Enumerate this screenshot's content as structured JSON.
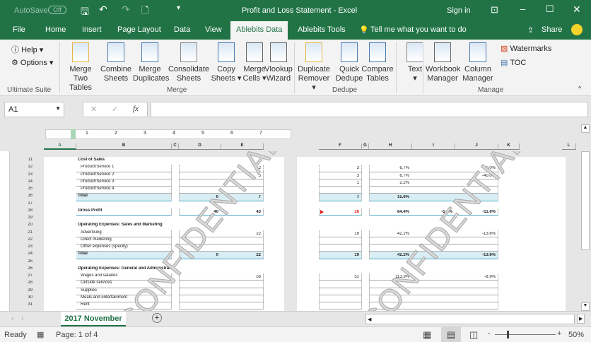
{
  "titlebar": {
    "autosave": "AutoSave",
    "autosave_state": "Off",
    "title": "Profit and Loss Statement  -  Excel",
    "sign_in": "Sign in"
  },
  "tabs": [
    "File",
    "Home",
    "Insert",
    "Page Layout",
    "Data",
    "View",
    "Ablebits Data",
    "Ablebits Tools"
  ],
  "tell_me": "Tell me what you want to do",
  "share": "Share",
  "ribbon": {
    "help": "Help",
    "options": "Options",
    "ultimate_suite": "Ultimate Suite",
    "merge_group": "Merge",
    "dedupe_group": "Dedupe",
    "manage_group": "Manage",
    "buttons": [
      {
        "l1": "Merge",
        "l2": "Two Tables"
      },
      {
        "l1": "Combine",
        "l2": "Sheets"
      },
      {
        "l1": "Merge",
        "l2": "Duplicates"
      },
      {
        "l1": "Consolidate",
        "l2": "Sheets"
      },
      {
        "l1": "Copy",
        "l2": "Sheets ▾"
      },
      {
        "l1": "Merge",
        "l2": "Cells ▾"
      },
      {
        "l1": "Vlookup",
        "l2": "Wizard"
      },
      {
        "l1": "Duplicate",
        "l2": "Remover ▾"
      },
      {
        "l1": "Quick",
        "l2": "Dedupe"
      },
      {
        "l1": "Compare",
        "l2": "Tables"
      },
      {
        "l1": "Text",
        "l2": "▾"
      },
      {
        "l1": "Workbook",
        "l2": "Manager"
      },
      {
        "l1": "Column",
        "l2": "Manager"
      }
    ],
    "watermarks": "Watermarks",
    "toc": "TOC"
  },
  "formula_bar": {
    "name_box": "A1",
    "fx": "fx",
    "value": ""
  },
  "ruler": [
    "1",
    "2",
    "3",
    "4",
    "5",
    "6",
    "7"
  ],
  "columns_left": [
    "A",
    "B",
    "C",
    "D",
    "E"
  ],
  "columns_right": [
    "F",
    "G",
    "H",
    "I",
    "J",
    "K",
    "L"
  ],
  "rows": [
    {
      "n": "11",
      "label": "Cost of Sales",
      "kind": "header"
    },
    {
      "n": "12",
      "label": "Product/Service 1",
      "kind": "item",
      "E": "2",
      "F": "3",
      "H": "6.7%",
      "J": "50.0%"
    },
    {
      "n": "13",
      "label": "Product/Service 2",
      "kind": "item",
      "E": "5",
      "F": "3",
      "H": "6.7%",
      "J": "-40.0%"
    },
    {
      "n": "14",
      "label": "Product/Service 3",
      "kind": "item",
      "F": "1",
      "H": "2.2%"
    },
    {
      "n": "15",
      "label": "Product/Service 4",
      "kind": "item"
    },
    {
      "n": "16",
      "label": "Total",
      "kind": "total",
      "D": "0",
      "E": "7",
      "F": "7",
      "H": "15.6%"
    },
    {
      "n": "17",
      "kind": "blank"
    },
    {
      "n": "18",
      "label": "Gross Profit",
      "kind": "gross",
      "D": "40",
      "E": "43",
      "F": "28",
      "H": "84.4%",
      "I": "-5.0%",
      "J": "-11.6%"
    },
    {
      "n": "19",
      "kind": "blank"
    },
    {
      "n": "20",
      "label": "Operating Expenses: Sales and Marketing",
      "kind": "header"
    },
    {
      "n": "21",
      "label": "Advertising",
      "kind": "item",
      "E": "22",
      "F": "19",
      "H": "42.2%",
      "J": "-13.6%"
    },
    {
      "n": "22",
      "label": "Direct marketing",
      "kind": "item"
    },
    {
      "n": "23",
      "label": "Other expenses (specify)",
      "kind": "item"
    },
    {
      "n": "24",
      "label": "Total",
      "kind": "total",
      "D": "0",
      "E": "22",
      "F": "19",
      "H": "42.2%",
      "J": "-13.6%"
    },
    {
      "n": "25",
      "kind": "blank"
    },
    {
      "n": "26",
      "label": "Operating Expenses: General and Administrative",
      "kind": "header"
    },
    {
      "n": "27",
      "label": "Wages and salaries",
      "kind": "item",
      "E": "56",
      "F": "51",
      "H": "113.3%",
      "J": "-8.9%"
    },
    {
      "n": "28",
      "label": "Outside services",
      "kind": "item"
    },
    {
      "n": "29",
      "label": "Supplies",
      "kind": "item"
    },
    {
      "n": "30",
      "label": "Meals and entertainment",
      "kind": "item"
    },
    {
      "n": "31",
      "label": "Rent",
      "kind": "item"
    }
  ],
  "watermark": "CONFIDENTIAL",
  "sheet_tab": "2017 November",
  "status": {
    "ready": "Ready",
    "page": "Page: 1 of 4",
    "zoom": "50%"
  },
  "colors": {
    "green": "#217346",
    "total_fill": "#d9eef4",
    "total_line": "#4aa8c8",
    "negative": "#e02020"
  }
}
